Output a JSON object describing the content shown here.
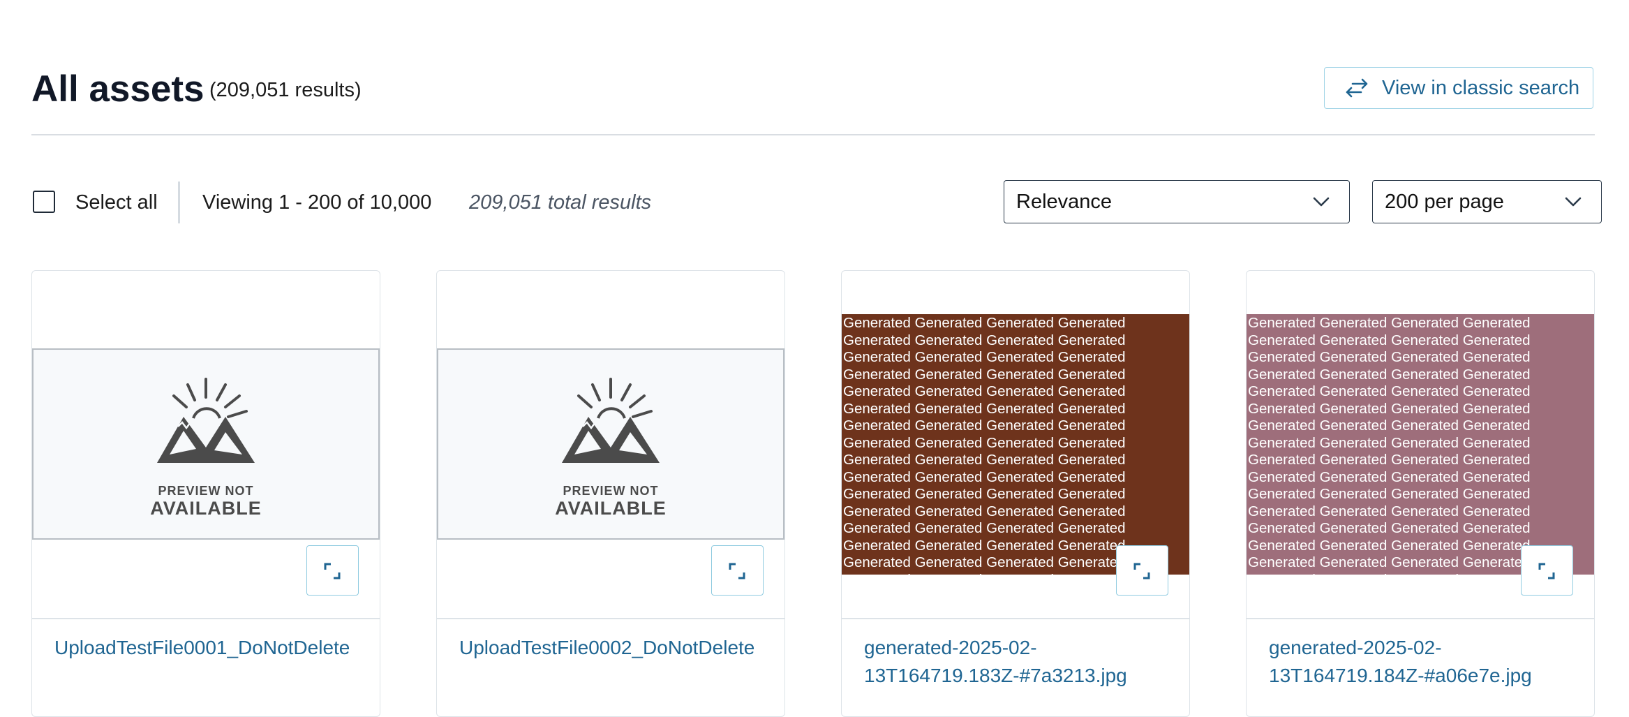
{
  "header": {
    "title": "All assets",
    "results_count": "(209,051 results)",
    "classic_search_label": "View in classic search",
    "classic_search_icon": "swap-arrows-icon"
  },
  "toolbar": {
    "select_all_label": "Select all",
    "viewing_label": "Viewing 1 - 200 of 10,000",
    "total_results_label": "209,051 total results",
    "sort_value": "Relevance",
    "per_page_value": "200 per page"
  },
  "cards": [
    {
      "name": "UploadTestFile0001_DoNotDelete",
      "preview": "placeholder",
      "preview_line1": "PREVIEW NOT",
      "preview_line2": "AVAILABLE"
    },
    {
      "name": "UploadTestFile0002_DoNotDelete",
      "preview": "placeholder",
      "preview_line1": "PREVIEW NOT",
      "preview_line2": "AVAILABLE"
    },
    {
      "name": "generated-2025-02-13T164719.183Z-#7a3213.jpg",
      "preview": "generated",
      "bg_color": "#6e331c",
      "text": "Generated Generated Generated Generated"
    },
    {
      "name": "generated-2025-02-13T164719.184Z-#a06e7e.jpg",
      "preview": "generated",
      "bg_color": "#9e6e7b",
      "text": "Generated Generated Generated Generated"
    }
  ],
  "colors": {
    "link": "#1f6592",
    "accent_border": "#9fd3e6"
  }
}
